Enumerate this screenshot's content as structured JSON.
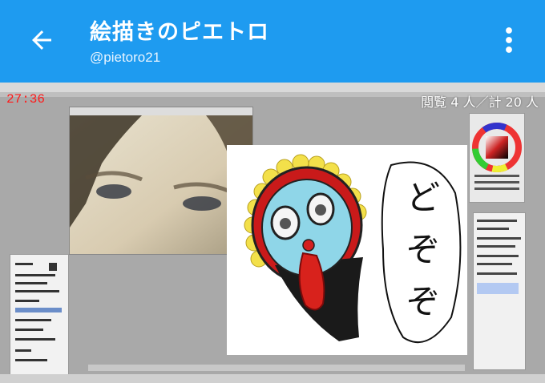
{
  "header": {
    "title": "絵描きのピエトロ",
    "handle": "@pietoro21"
  },
  "icons": {
    "back": "arrow-back-icon",
    "menu": "more-vert-icon"
  },
  "stream": {
    "timer": "27:36",
    "viewers": "閲覧 4 人／計 20 人"
  },
  "canvas": {
    "speech_text": "どぞぞ"
  },
  "colors": {
    "appbar": "#1e9bf0",
    "timer": "#ff1a1a"
  }
}
